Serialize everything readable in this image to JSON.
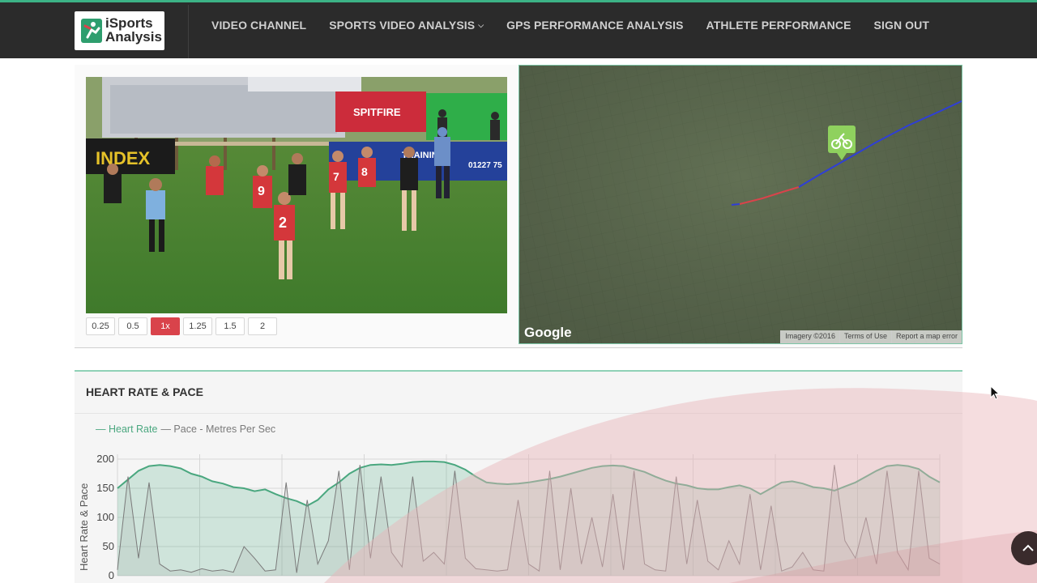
{
  "brand": {
    "line1": "iSports",
    "line2": "Analysis"
  },
  "nav": {
    "items": [
      {
        "label": "VIDEO CHANNEL"
      },
      {
        "label": "SPORTS VIDEO ANALYSIS"
      },
      {
        "label": "GPS PERFORMANCE ANALYSIS"
      },
      {
        "label": "ATHLETE PERFORMANCE"
      },
      {
        "label": "SIGN OUT"
      }
    ]
  },
  "video": {
    "ad_boards": [
      "INDEX",
      "SPITFIRE",
      "TRAINING",
      "01227 75"
    ],
    "jersey_numbers": [
      "9",
      "7",
      "2",
      "8"
    ]
  },
  "playback": {
    "speeds": [
      "0.25",
      "0.5",
      "1x",
      "1.25",
      "1.5",
      "2"
    ],
    "active": "1x"
  },
  "map": {
    "provider": "Google",
    "footer": [
      "Imagery ©2016",
      "Terms of Use",
      "Report a map error"
    ]
  },
  "heart_panel": {
    "title": "HEART RATE & PACE",
    "legend": [
      {
        "name": "Heart Rate",
        "color": "#4aa77f"
      },
      {
        "name": "Pace - Metres Per Sec",
        "color": "#7a7a7a"
      }
    ]
  },
  "chart_data": {
    "type": "area",
    "ylabel": "Heart Rate & Pace",
    "ylim": [
      0,
      200
    ],
    "yticks": [
      0,
      50,
      100,
      150,
      200
    ],
    "grid": true,
    "series": [
      {
        "name": "Heart Rate",
        "color": "#4aa77f",
        "values": [
          150,
          165,
          180,
          188,
          190,
          188,
          184,
          175,
          170,
          162,
          158,
          152,
          150,
          145,
          148,
          140,
          133,
          128,
          120,
          130,
          148,
          160,
          175,
          185,
          190,
          191,
          190,
          192,
          195,
          196,
          196,
          195,
          190,
          182,
          170,
          160,
          158,
          157,
          158,
          160,
          163,
          166,
          170,
          175,
          180,
          185,
          188,
          189,
          188,
          183,
          178,
          170,
          163,
          158,
          155,
          150,
          148,
          148,
          152,
          155,
          150,
          140,
          150,
          160,
          162,
          158,
          152,
          150,
          146,
          153,
          160,
          170,
          180,
          188,
          190,
          188,
          183,
          170,
          160
        ]
      },
      {
        "name": "Pace - Metres Per Sec",
        "color": "#7a7a7a",
        "values": [
          10,
          170,
          30,
          160,
          20,
          8,
          10,
          6,
          12,
          8,
          10,
          6,
          50,
          30,
          8,
          10,
          160,
          5,
          130,
          20,
          60,
          180,
          10,
          190,
          30,
          170,
          40,
          15,
          170,
          25,
          40,
          20,
          180,
          30,
          12,
          10,
          8,
          10,
          130,
          20,
          8,
          180,
          10,
          150,
          20,
          100,
          15,
          140,
          10,
          180,
          20,
          10,
          8,
          170,
          20,
          130,
          25,
          10,
          60,
          20,
          140,
          10,
          120,
          8,
          15,
          40,
          10,
          8,
          190,
          60,
          30,
          100,
          20,
          180,
          40,
          10,
          180,
          30,
          20
        ]
      }
    ]
  }
}
